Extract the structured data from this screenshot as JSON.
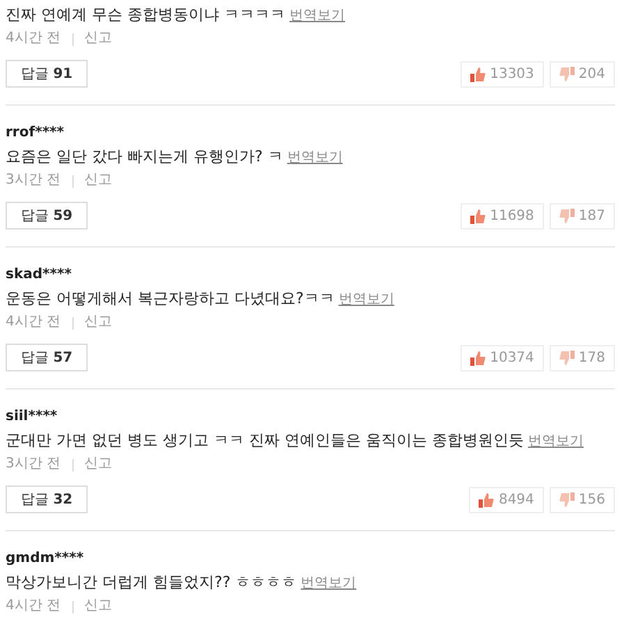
{
  "comments": [
    {
      "text": "진짜 연예계 무슨 종합병동이냐 ㅋㅋㅋㅋ",
      "translate": "번역보기",
      "time": "4시간 전",
      "report": "신고",
      "reply_label": "답글",
      "reply_count": "91",
      "likes": "13303",
      "dislikes": "204"
    },
    {
      "author": "rrof****",
      "text": "요즘은 일단 갔다 빠지는게 유행인가? ㅋ",
      "translate": "번역보기",
      "time": "3시간 전",
      "report": "신고",
      "reply_label": "답글",
      "reply_count": "59",
      "likes": "11698",
      "dislikes": "187"
    },
    {
      "author": "skad****",
      "text": "운동은 어떻게해서 복근자랑하고 다녔대요?ㅋㅋ",
      "translate": "번역보기",
      "time": "4시간 전",
      "report": "신고",
      "reply_label": "답글",
      "reply_count": "57",
      "likes": "10374",
      "dislikes": "178"
    },
    {
      "author": "siil****",
      "text": "군대만 가면 없던 병도 생기고 ㅋㅋ 진짜 연예인들은 움직이는 종합병원인듯",
      "translate": "번역보기",
      "time": "3시간 전",
      "report": "신고",
      "reply_label": "답글",
      "reply_count": "32",
      "likes": "8494",
      "dislikes": "156"
    },
    {
      "author": "gmdm****",
      "text": "막상가보니간 더럽게 힘들었지?? ㅎㅎㅎㅎ",
      "translate": "번역보기",
      "time": "4시간 전",
      "report": "신고"
    }
  ]
}
